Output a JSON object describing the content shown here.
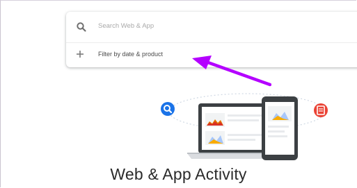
{
  "search": {
    "placeholder": "Search Web & App",
    "icon": "search-icon"
  },
  "filter": {
    "label": "Filter by date & product",
    "icon": "plus-icon"
  },
  "annotation": {
    "arrow_color": "#b400ff"
  },
  "hero": {
    "title": "Web & App Activity",
    "left_badge_icon": "search-icon",
    "right_badge_icon": "book-icon",
    "left_badge_color": "#1a73e8",
    "right_badge_color": "#ea4335"
  }
}
